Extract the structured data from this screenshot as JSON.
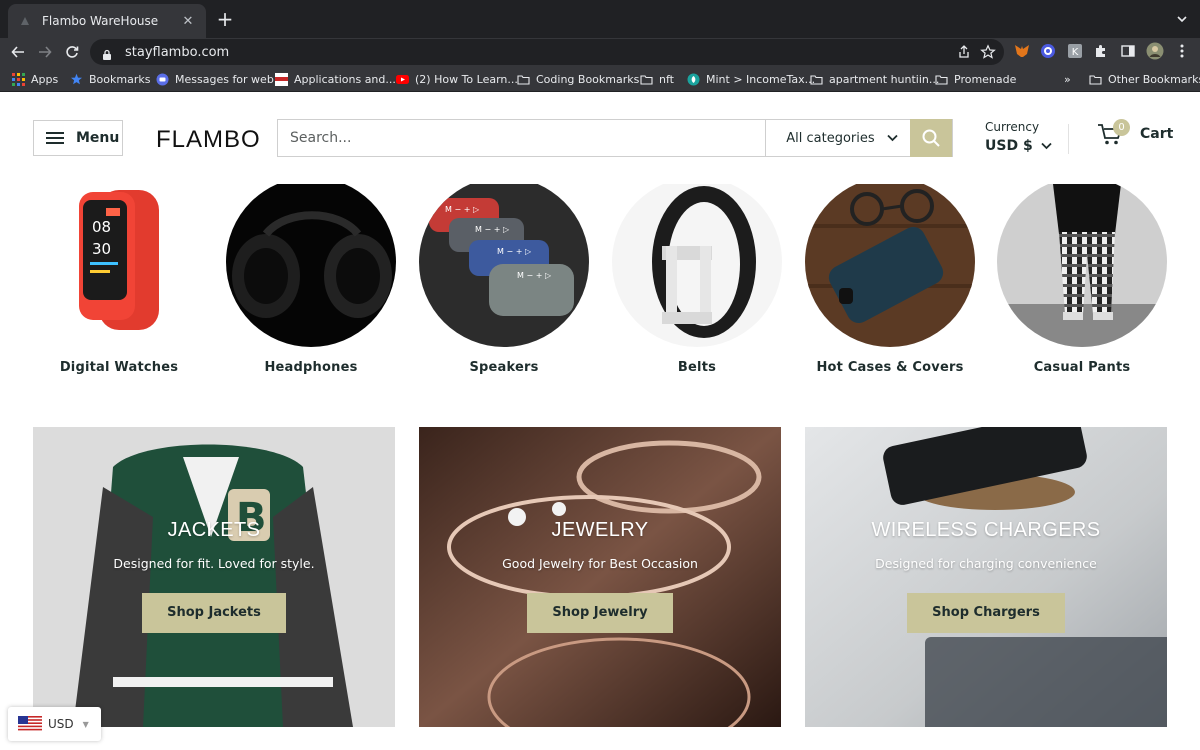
{
  "browser": {
    "tab": {
      "title": "Flambo WareHouse",
      "favicon": "flambo-favicon-icon"
    },
    "url": "stayflambo.com",
    "bookmarks": [
      {
        "label": "Apps",
        "icon": "apps-grid-icon"
      },
      {
        "label": "Bookmarks",
        "icon": "star-icon"
      },
      {
        "label": "Messages for web",
        "icon": "messages-icon"
      },
      {
        "label": "Applications and...",
        "icon": "usa-jobs-icon"
      },
      {
        "label": "(2) How To Learn...",
        "icon": "youtube-icon"
      },
      {
        "label": "Coding Bookmarks",
        "icon": "folder-icon"
      },
      {
        "label": "nft",
        "icon": "folder-icon"
      },
      {
        "label": "Mint > IncomeTax...",
        "icon": "mint-icon"
      },
      {
        "label": "apartment huntiin...",
        "icon": "folder-icon"
      },
      {
        "label": "Promenade",
        "icon": "folder-icon"
      }
    ],
    "overflow_label": "»",
    "other_bookmarks": "Other Bookmarks"
  },
  "header": {
    "menu_label": "Menu",
    "logo_text": "FLAMBO",
    "search_placeholder": "Search...",
    "category_select": "All categories",
    "currency_label": "Currency",
    "currency_value": "USD $",
    "cart_count": "0",
    "cart_label": "Cart"
  },
  "categories": [
    {
      "name": "Digital Watches"
    },
    {
      "name": "Headphones"
    },
    {
      "name": "Speakers"
    },
    {
      "name": "Belts"
    },
    {
      "name": "Hot Cases & Covers"
    },
    {
      "name": "Casual Pants"
    }
  ],
  "promos": [
    {
      "title": "JACKETS",
      "subtitle": "Designed for fit. Loved for style.",
      "button": "Shop Jackets"
    },
    {
      "title": "JEWELRY",
      "subtitle": "Good Jewelry for Best Occasion",
      "button": "Shop Jewelry"
    },
    {
      "title": "WIRELESS CHARGERS",
      "subtitle": "Designed for charging convenience",
      "button": "Shop Chargers"
    }
  ],
  "currency_widget": {
    "label": "USD",
    "flag": "us-flag-icon"
  },
  "colors": {
    "accent": "#c9c59a",
    "text": "#1e2d2d",
    "chrome_dark": "#202124",
    "chrome": "#35363a"
  }
}
